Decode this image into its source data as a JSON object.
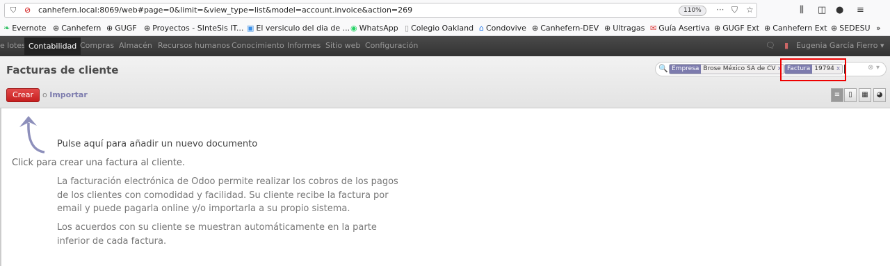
{
  "browser": {
    "url": "canhefern.local:8069/web#page=0&limit=&view_type=list&model=account.invoice&action=269",
    "zoom": "110%"
  },
  "bookmarks": [
    {
      "label": "Evernote",
      "icon": "evernote-icon"
    },
    {
      "label": "Canhefern",
      "icon": "globe-icon"
    },
    {
      "label": "GUGF",
      "icon": "globe-icon"
    },
    {
      "label": "Proyectos - SInteSis IT...",
      "icon": "globe-icon"
    },
    {
      "label": "El versiculo del dia de ...",
      "icon": "image-icon"
    },
    {
      "label": "WhatsApp",
      "icon": "whatsapp-icon"
    },
    {
      "label": "Colegio Oakland",
      "icon": "page-icon"
    },
    {
      "label": "Condovive",
      "icon": "house-icon"
    },
    {
      "label": "Canhefern-DEV",
      "icon": "globe-icon"
    },
    {
      "label": "Ultragas",
      "icon": "globe-icon"
    },
    {
      "label": "Guía Asertiva",
      "icon": "mail-icon"
    },
    {
      "label": "GUGF Ext",
      "icon": "globe-icon"
    },
    {
      "label": "Canhefern Ext",
      "icon": "globe-icon"
    },
    {
      "label": "SEDESU",
      "icon": "globe-icon"
    }
  ],
  "topmenu": {
    "items": [
      "e lotes",
      "Contabilidad",
      "Compras",
      "Almacén",
      "Recursos humanos",
      "Conocimiento",
      "Informes",
      "Sitio web",
      "Configuración"
    ],
    "active_index": 1,
    "user": "Eugenia García Fierro"
  },
  "control": {
    "title": "Facturas de cliente",
    "create_label": "Crear",
    "or_label": "o",
    "import_label": "Importar",
    "facets": [
      {
        "category": "Empresa",
        "value": "Brose México SA de CV"
      },
      {
        "category": "Factura",
        "value": "19794"
      }
    ]
  },
  "help": {
    "title": "Pulse aquí para añadir un nuevo documento",
    "subtitle": "Click para crear una factura al cliente.",
    "p1": "La facturación electrónica de Odoo permite realizar los cobros de los pagos de los clientes con comodidad y facilidad. Su cliente recibe la factura por email y puede pagarla online y/o importarla a su propio sistema.",
    "p2": "Los acuerdos con su cliente se muestran automáticamente en la parte inferior de cada factura."
  },
  "colors": {
    "create_button": "#dc2c2c",
    "facet_category": "#7c7bad",
    "topbar": "#414141",
    "highlight_box": "#ee0000"
  }
}
